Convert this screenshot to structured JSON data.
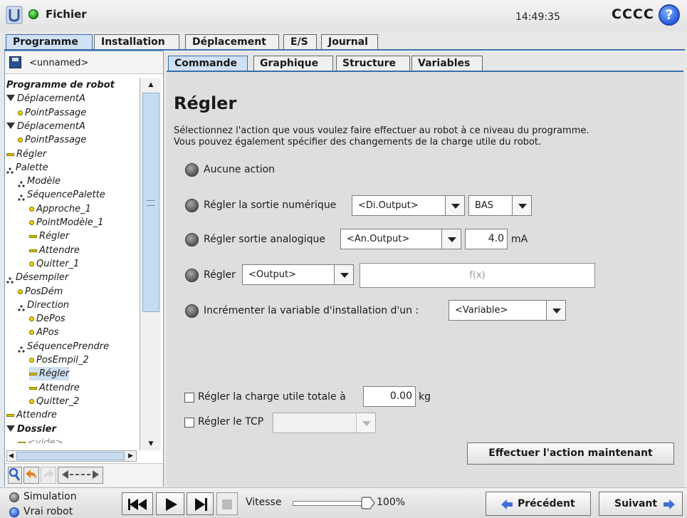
{
  "header": {
    "menu_label": "Fichier",
    "time": "14:49:35",
    "robot_name": "CCCC",
    "help_glyph": "?"
  },
  "main_tabs": [
    "Programme",
    "Installation",
    "Déplacement",
    "E/S",
    "Journal"
  ],
  "main_tabs_active": "Programme",
  "program": {
    "filename": "<unnamed>"
  },
  "tree": [
    {
      "label": "Programme de robot",
      "icon": "none",
      "depth": 0,
      "bold": true
    },
    {
      "label": "DéplacementA",
      "icon": "move-triangle-icon",
      "depth": 0
    },
    {
      "label": "PointPassage",
      "icon": "waypoint-icon",
      "depth": 1
    },
    {
      "label": "DéplacementA",
      "icon": "move-triangle-icon",
      "depth": 0
    },
    {
      "label": "PointPassage",
      "icon": "waypoint-icon",
      "depth": 1
    },
    {
      "label": "Régler",
      "icon": "set-bar-icon",
      "depth": 0
    },
    {
      "label": "Palette",
      "icon": "pallet-icon",
      "depth": 0
    },
    {
      "label": "Modèle",
      "icon": "pallet-icon",
      "depth": 1
    },
    {
      "label": "SéquencePalette",
      "icon": "pallet-icon",
      "depth": 1
    },
    {
      "label": "Approche_1",
      "icon": "waypoint-icon",
      "depth": 2
    },
    {
      "label": "PointModèle_1",
      "icon": "waypoint-icon",
      "depth": 2
    },
    {
      "label": "Régler",
      "icon": "set-bar-icon",
      "depth": 2
    },
    {
      "label": "Attendre",
      "icon": "set-bar-icon",
      "depth": 2
    },
    {
      "label": "Quitter_1",
      "icon": "waypoint-icon",
      "depth": 2
    },
    {
      "label": "Désempiler",
      "icon": "pallet-icon",
      "depth": 0
    },
    {
      "label": "PosDém",
      "icon": "waypoint-icon",
      "depth": 1
    },
    {
      "label": "Direction",
      "icon": "pallet-icon",
      "depth": 1
    },
    {
      "label": "DePos",
      "icon": "waypoint-icon",
      "depth": 2
    },
    {
      "label": "APos",
      "icon": "waypoint-icon",
      "depth": 2
    },
    {
      "label": "SéquencePrendre",
      "icon": "pallet-icon",
      "depth": 1
    },
    {
      "label": "PosEmpil_2",
      "icon": "waypoint-icon",
      "depth": 2
    },
    {
      "label": "Régler",
      "icon": "set-bar-icon",
      "depth": 2,
      "selected": true
    },
    {
      "label": "Attendre",
      "icon": "set-bar-icon",
      "depth": 2
    },
    {
      "label": "Quitter_2",
      "icon": "waypoint-icon",
      "depth": 2
    },
    {
      "label": "Attendre",
      "icon": "set-bar-icon",
      "depth": 0
    },
    {
      "label": "Dossier",
      "icon": "move-triangle-icon",
      "depth": 0,
      "bold": true
    },
    {
      "label": "<vide>",
      "icon": "set-bar-icon",
      "depth": 1,
      "muted": true
    }
  ],
  "sub_tabs": [
    "Commande",
    "Graphique",
    "Structure",
    "Variables"
  ],
  "sub_tabs_active": "Commande",
  "command": {
    "title": "Régler",
    "description": "Sélectionnez l'action que vous voulez faire effectuer au robot à ce niveau du programme.\nVous pouvez également spécifier des changements de la charge utile du robot.",
    "opt_none": "Aucune action",
    "opt_digital": "Régler la sortie numérique",
    "digital_output": "<Di.Output>",
    "digital_state": "BAS",
    "opt_analog": "Régler sortie analogique",
    "analog_output": "<An.Output>",
    "analog_value": "4.0",
    "analog_unit": "mA",
    "opt_expr": "Régler",
    "expr_output": "<Output>",
    "expr_formula": "f(x)",
    "opt_increment": "Incrémenter la variable d'installation d'un :",
    "increment_var": "<Variable>",
    "payload_label": "Régler la charge utile totale à",
    "payload_value": "0.00",
    "payload_unit": "kg",
    "tcp_label": "Régler le TCP",
    "execute_button": "Effectuer l'action maintenant"
  },
  "footer": {
    "simulation": "Simulation",
    "real_robot": "Vrai robot",
    "speed_label": "Vitesse",
    "speed_value": "100%",
    "speed_fraction": 1.0,
    "previous": "Précédent",
    "next": "Suivant"
  },
  "colors": {
    "accent": "#3a6ea8",
    "active_tab": "#cfe1f5",
    "selected_row": "#cfe0f2",
    "arrow_blue": "#3f6fd8",
    "orange": "#e87f24"
  }
}
